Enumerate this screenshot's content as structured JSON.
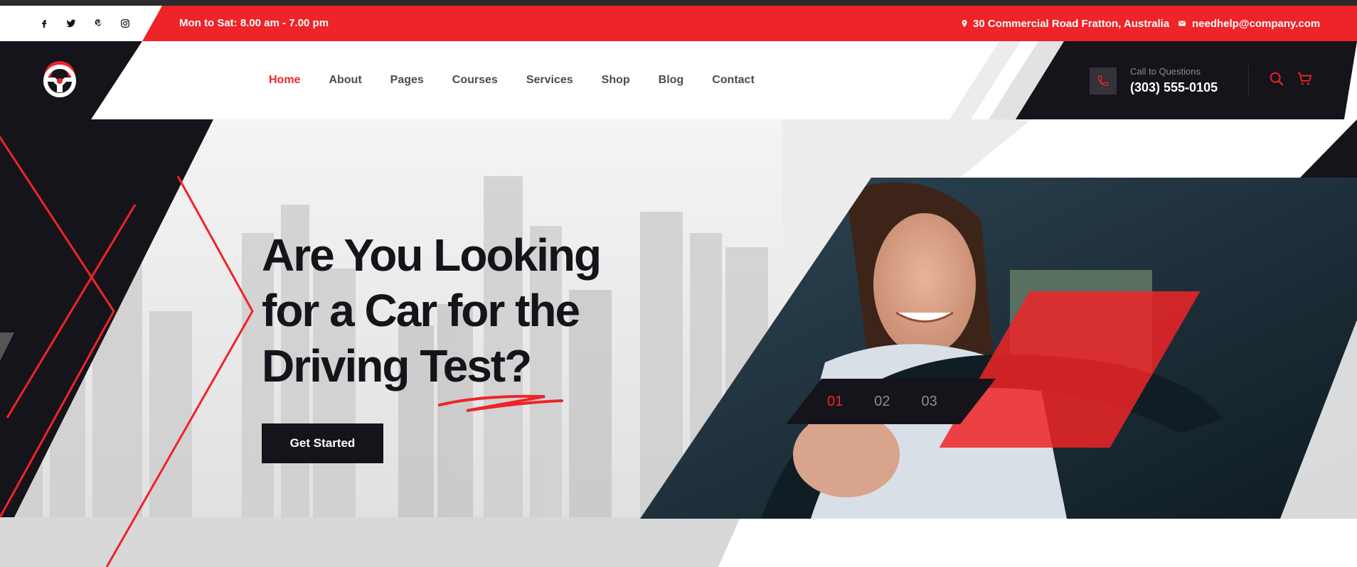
{
  "topbar": {
    "socials": [
      "facebook-icon",
      "twitter-icon",
      "pinterest-icon",
      "instagram-icon"
    ],
    "hours": "Mon to Sat: 8.00 am - 7.00 pm",
    "address": "30 Commercial Road Fratton, Australia",
    "email": "needhelp@company.com"
  },
  "nav": {
    "items": [
      {
        "label": "Home",
        "active": true
      },
      {
        "label": "About",
        "active": false
      },
      {
        "label": "Pages",
        "active": false
      },
      {
        "label": "Courses",
        "active": false
      },
      {
        "label": "Services",
        "active": false
      },
      {
        "label": "Shop",
        "active": false
      },
      {
        "label": "Blog",
        "active": false
      },
      {
        "label": "Contact",
        "active": false
      }
    ]
  },
  "contact": {
    "call_label": "Call to Questions",
    "call_number": "(303) 555-0105"
  },
  "hero": {
    "title_line1": "Are You Looking",
    "title_line2": "for a Car for the",
    "title_line3": "Driving Test?",
    "cta_label": "Get Started",
    "slides": [
      {
        "label": "01",
        "active": true
      },
      {
        "label": "02",
        "active": false
      },
      {
        "label": "03",
        "active": false
      }
    ]
  },
  "colors": {
    "accent": "#ee2428",
    "dark": "#15141a",
    "muted": "#4b4b55"
  }
}
